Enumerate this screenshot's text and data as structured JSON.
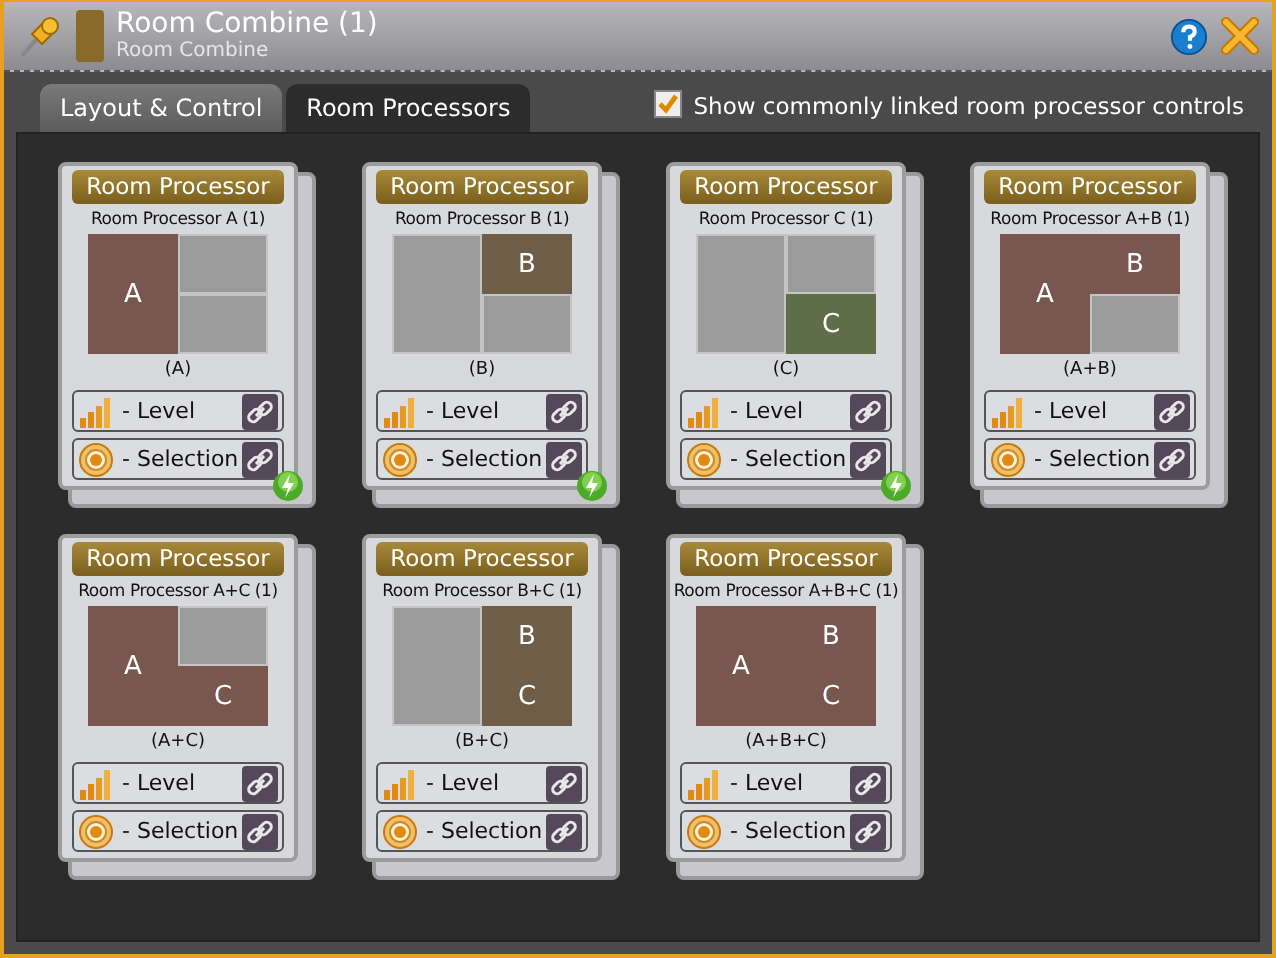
{
  "window": {
    "title": "Room Combine (1)",
    "subtitle": "Room Combine"
  },
  "tabs": [
    {
      "label": "Layout & Control",
      "selected": false
    },
    {
      "label": "Room Processors",
      "selected": true
    }
  ],
  "show_linked": {
    "label": "Show commonly linked room processor controls",
    "checked": true
  },
  "cards": [
    {
      "header": "Room Processor",
      "name": "Room Processor A (1)",
      "caption": "(A)",
      "color": "#7a5650",
      "linked": true,
      "zones": [
        {
          "active": true,
          "label": "A"
        },
        {
          "active": false
        },
        {
          "active": false
        }
      ],
      "controls": [
        {
          "kind": "level",
          "label": "- Level"
        },
        {
          "kind": "selection",
          "label": "- Selection"
        }
      ]
    },
    {
      "header": "Room Processor",
      "name": "Room Processor B (1)",
      "caption": "(B)",
      "color": "#6e5e48",
      "linked": true,
      "zones": [
        {
          "active": false
        },
        {
          "active": true,
          "label": "B"
        },
        {
          "active": false
        }
      ],
      "controls": [
        {
          "kind": "level",
          "label": "- Level"
        },
        {
          "kind": "selection",
          "label": "- Selection"
        }
      ]
    },
    {
      "header": "Room Processor",
      "name": "Room Processor C (1)",
      "caption": "(C)",
      "color": "#5e6e48",
      "linked": true,
      "zones": [
        {
          "active": false
        },
        {
          "active": false
        },
        {
          "active": true,
          "label": "C"
        }
      ],
      "controls": [
        {
          "kind": "level",
          "label": "- Level"
        },
        {
          "kind": "selection",
          "label": "- Selection"
        }
      ]
    },
    {
      "header": "Room Processor",
      "name": "Room Processor A+B (1)",
      "caption": "(A+B)",
      "color": "#7a5650",
      "linked": false,
      "zones": [
        {
          "active": true,
          "label": "A"
        },
        {
          "active": true,
          "label": "B"
        },
        {
          "active": false
        }
      ],
      "controls": [
        {
          "kind": "level",
          "label": "- Level"
        },
        {
          "kind": "selection",
          "label": "- Selection"
        }
      ]
    },
    {
      "header": "Room Processor",
      "name": "Room Processor A+C (1)",
      "caption": "(A+C)",
      "color": "#7a5650",
      "linked": false,
      "zones": [
        {
          "active": true,
          "label": "A"
        },
        {
          "active": false
        },
        {
          "active": true,
          "label": "C"
        }
      ],
      "controls": [
        {
          "kind": "level",
          "label": "- Level"
        },
        {
          "kind": "selection",
          "label": "- Selection"
        }
      ]
    },
    {
      "header": "Room Processor",
      "name": "Room Processor B+C (1)",
      "caption": "(B+C)",
      "color": "#6e5e48",
      "linked": false,
      "zones": [
        {
          "active": false
        },
        {
          "active": true,
          "label": "B"
        },
        {
          "active": true,
          "label": "C"
        }
      ],
      "controls": [
        {
          "kind": "level",
          "label": "- Level"
        },
        {
          "kind": "selection",
          "label": "- Selection"
        }
      ]
    },
    {
      "header": "Room Processor",
      "name": "Room Processor A+B+C (1)",
      "caption": "(A+B+C)",
      "color": "#7a5650",
      "linked": false,
      "zones": [
        {
          "active": true,
          "label": "A"
        },
        {
          "active": true,
          "label": "B"
        },
        {
          "active": true,
          "label": "C"
        }
      ],
      "controls": [
        {
          "kind": "level",
          "label": "- Level"
        },
        {
          "kind": "selection",
          "label": "- Selection"
        }
      ]
    }
  ]
}
